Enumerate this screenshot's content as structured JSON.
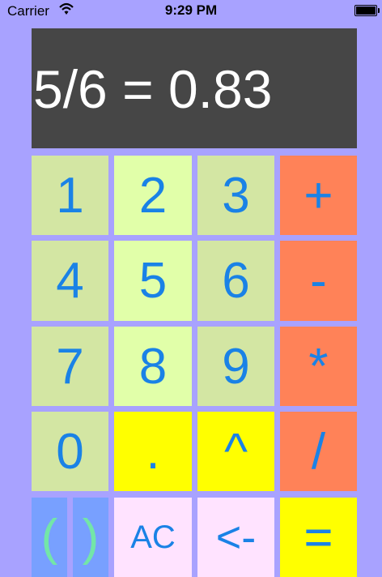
{
  "status_bar": {
    "carrier": "Carrier",
    "time": "9:29 PM"
  },
  "display": {
    "text": "5/6 = 0.83"
  },
  "keys": {
    "k1": "1",
    "k2": "2",
    "k3": "3",
    "plus": "+",
    "k4": "4",
    "k5": "5",
    "k6": "6",
    "minus": "-",
    "k7": "7",
    "k8": "8",
    "k9": "9",
    "multiply": "*",
    "k0": "0",
    "decimal": ".",
    "power": "^",
    "divide": "/",
    "open_paren": "(",
    "close_paren": ")",
    "clear": "AC",
    "backspace": "<-",
    "equals": "="
  },
  "colors": {
    "background": "#a8a2ff",
    "display": "#464646",
    "digit_green": "#d3e6a3",
    "digit_light": "#e1ffa9",
    "operator": "#ff8258",
    "highlight": "#ffff00",
    "pink": "#ffe3ff",
    "paren": "#78a0ff",
    "key_text": "#1a82e6"
  }
}
